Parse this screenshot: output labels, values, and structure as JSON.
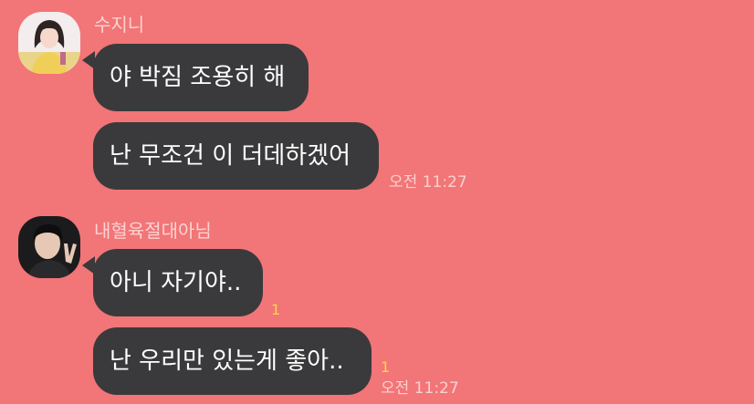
{
  "colors": {
    "background": "#f27577",
    "bubble": "#3a3a3c",
    "unread": "#ffd54a"
  },
  "groups": [
    {
      "sender": "수지니",
      "avatar_icon": "profile-photo-girl",
      "messages": [
        {
          "text": "야 박짐 조용히 해"
        },
        {
          "text": "난 무조건 이 더데하겠어",
          "time": "오전 11:27"
        }
      ]
    },
    {
      "sender": "내혈육절대아님",
      "avatar_icon": "profile-photo-boy",
      "messages": [
        {
          "text": "아니 자기야..",
          "unread": "1"
        },
        {
          "text": "난 우리만 있는게 좋아..",
          "unread": "1",
          "time": "오전 11:27"
        }
      ]
    }
  ]
}
